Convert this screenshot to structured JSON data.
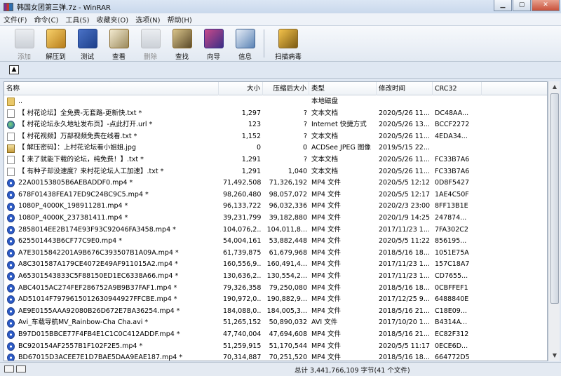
{
  "window": {
    "title": "韩国女团第三弹.7z - WinRAR"
  },
  "menu": [
    "文件(F)",
    "命令(C)",
    "工具(S)",
    "收藏夹(O)",
    "选项(N)",
    "帮助(H)"
  ],
  "toolbar": [
    {
      "label": "添加",
      "icon": "add-icon",
      "enabled": false
    },
    {
      "label": "解压到",
      "icon": "extract-icon",
      "enabled": true
    },
    {
      "label": "测试",
      "icon": "test-icon",
      "enabled": true
    },
    {
      "label": "查看",
      "icon": "view-icon",
      "enabled": true
    },
    {
      "label": "删除",
      "icon": "delete-icon",
      "enabled": false
    },
    {
      "label": "查找",
      "icon": "find-icon",
      "enabled": true
    },
    {
      "label": "向导",
      "icon": "wizard-icon",
      "enabled": true
    },
    {
      "label": "信息",
      "icon": "info-icon",
      "enabled": true
    },
    {
      "label": "扫描病毒",
      "icon": "scan-virus-icon",
      "enabled": true
    }
  ],
  "columns": [
    "名称",
    "大小",
    "压缩后大小",
    "类型",
    "修改时间",
    "CRC32"
  ],
  "files": [
    {
      "name": "..",
      "size": "",
      "packed": "",
      "type": "本地磁盘",
      "modified": "",
      "crc": "",
      "icon": "folder"
    },
    {
      "name": "【 村花论坛】全免费-无套路-更新快.txt *",
      "size": "1,297",
      "packed": "?",
      "type": "文本文档",
      "modified": "2020/5/26 11...",
      "crc": "DC48AA...",
      "icon": "txt"
    },
    {
      "name": "【 村花论坛永久地址发布页】-点此打开.url *",
      "size": "123",
      "packed": "?",
      "type": "Internet 快捷方式",
      "modified": "2020/5/26 13...",
      "crc": "BCCF2272",
      "icon": "url"
    },
    {
      "name": "【 村花视频】万部视频免费在线看.txt *",
      "size": "1,152",
      "packed": "?",
      "type": "文本文档",
      "modified": "2020/5/26 11...",
      "crc": "4EDA34...",
      "icon": "txt"
    },
    {
      "name": "【 解压密码】：上村花论坛看小姐姐.jpg",
      "size": "0",
      "packed": "0",
      "type": "ACDSee JPEG 图像",
      "modified": "2019/5/15 22...",
      "crc": "",
      "icon": "jpg"
    },
    {
      "name": "【 来了就能下载的论坛，纯免费！】.txt *",
      "size": "1,291",
      "packed": "?",
      "type": "文本文档",
      "modified": "2020/5/26 11...",
      "crc": "FC33B7A6",
      "icon": "txt"
    },
    {
      "name": "【 有种子却没速度？来村花论坛人工加速】.txt *",
      "size": "1,291",
      "packed": "1,040",
      "type": "文本文档",
      "modified": "2020/5/26 11...",
      "crc": "FC33B7A6",
      "icon": "txt"
    },
    {
      "name": "22A00153805B6AEBADDF0.mp4 *",
      "size": "71,492,508",
      "packed": "71,326,192",
      "type": "MP4 文件",
      "modified": "2020/5/5 12:12",
      "crc": "0D8F5427",
      "icon": "media"
    },
    {
      "name": "678F01438FEA17ED9C24BC9C5.mp4 *",
      "size": "98,260,480",
      "packed": "98,057,072",
      "type": "MP4 文件",
      "modified": "2020/5/5 12:17",
      "crc": "1AE4C50F",
      "icon": "media"
    },
    {
      "name": "1080P_4000K_198911281.mp4 *",
      "size": "96,133,722",
      "packed": "96,032,336",
      "type": "MP4 文件",
      "modified": "2020/2/3 23:00",
      "crc": "8FF13B1E",
      "icon": "media"
    },
    {
      "name": "1080P_4000K_237381411.mp4 *",
      "size": "39,231,799",
      "packed": "39,182,880",
      "type": "MP4 文件",
      "modified": "2020/1/9 14:25",
      "crc": "247874...",
      "icon": "media"
    },
    {
      "name": "2858014EE2B174E93F93C92046FA3458.mp4 *",
      "size": "104,076,2...",
      "packed": "104,011,8...",
      "type": "MP4 文件",
      "modified": "2017/11/23 1...",
      "crc": "7FA302C2",
      "icon": "media"
    },
    {
      "name": "625501443B6CF77C9E0.mp4 *",
      "size": "54,004,161",
      "packed": "53,882,448",
      "type": "MP4 文件",
      "modified": "2020/5/5 11:22",
      "crc": "856195...",
      "icon": "media"
    },
    {
      "name": "A7E3015842201A9B676C393507B1A09A.mp4 *",
      "size": "61,739,875",
      "packed": "61,679,968",
      "type": "MP4 文件",
      "modified": "2018/5/16 18...",
      "crc": "1051E75A",
      "icon": "media"
    },
    {
      "name": "A8C301587A179CE4072E49AF911015A2.mp4 *",
      "size": "160,556,9...",
      "packed": "160,491,4...",
      "type": "MP4 文件",
      "modified": "2017/11/23 1...",
      "crc": "157C18A7",
      "icon": "media"
    },
    {
      "name": "A65301543833C5F88150ED1EC6338A66.mp4 *",
      "size": "130,636,2...",
      "packed": "130,554,2...",
      "type": "MP4 文件",
      "modified": "2017/11/23 1...",
      "crc": "CD7655...",
      "icon": "media"
    },
    {
      "name": "ABC4015AC274FEF286752A9B9B37FAF1.mp4 *",
      "size": "79,326,358",
      "packed": "79,250,080",
      "type": "MP4 文件",
      "modified": "2018/5/16 18...",
      "crc": "0CBFFEF1",
      "icon": "media"
    },
    {
      "name": "AD51014F7979615012630944927FFCBE.mp4 *",
      "size": "190,972,0...",
      "packed": "190,882,9...",
      "type": "MP4 文件",
      "modified": "2017/12/25 9...",
      "crc": "6488840E",
      "icon": "media"
    },
    {
      "name": "AE9E0155AAA92080B26D672E7BA36254.mp4 *",
      "size": "184,088,0...",
      "packed": "184,005,3...",
      "type": "MP4 文件",
      "modified": "2018/5/16 21...",
      "crc": "C18E09...",
      "icon": "media"
    },
    {
      "name": "Avi_车载导航MV_Rainbow-Cha Cha.avi *",
      "size": "51,265,152",
      "packed": "50,890,032",
      "type": "AVI 文件",
      "modified": "2017/10/20 1...",
      "crc": "B4314A...",
      "icon": "avi"
    },
    {
      "name": "B97D015BBCE77F4FB4E1C1C0C412ADDF.mp4 *",
      "size": "47,740,004",
      "packed": "47,694,608",
      "type": "MP4 文件",
      "modified": "2018/5/16 21...",
      "crc": "EC82F312",
      "icon": "media"
    },
    {
      "name": "BC920154AF2557B1F102F2E5.mp4 *",
      "size": "51,259,915",
      "packed": "51,170,544",
      "type": "MP4 文件",
      "modified": "2020/5/5 11:17",
      "crc": "0ECE6D...",
      "icon": "media"
    },
    {
      "name": "BD67015D3ACEE7E1D7BAE5DAA9EAE187.mp4 *",
      "size": "70,314,887",
      "packed": "70,251,520",
      "type": "MP4 文件",
      "modified": "2018/5/16 18...",
      "crc": "664772D5",
      "icon": "media"
    }
  ],
  "status": {
    "total": "总计 3,441,766,109 字节(41 个文件)"
  }
}
